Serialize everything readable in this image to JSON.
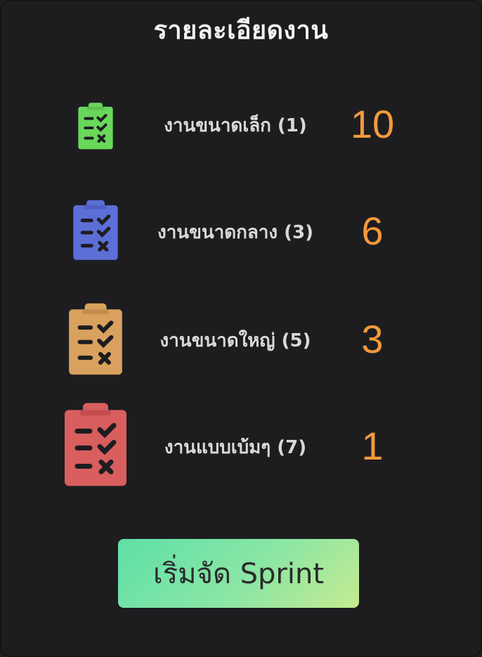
{
  "title": "รายละเอียดงาน",
  "tasks": [
    {
      "label": "งานขนาดเล็ก (1)",
      "count": "10",
      "icon": "clipboard-checklist-icon",
      "color": "#69d75a"
    },
    {
      "label": "งานขนาดกลาง (3)",
      "count": "6",
      "icon": "clipboard-checklist-icon",
      "color": "#5b6fd6"
    },
    {
      "label": "งานขนาดใหญ่ (5)",
      "count": "3",
      "icon": "clipboard-checklist-icon",
      "color": "#d9a15e"
    },
    {
      "label": "งานแบบเบ้มๆ (7)",
      "count": "1",
      "icon": "clipboard-checklist-icon",
      "color": "#d95e5e"
    }
  ],
  "start_button": {
    "label": "เริ่มจัด Sprint"
  },
  "colors": {
    "background": "#1d1d20",
    "count": "#f39a3a",
    "button_gradient_start": "#5fe0a8",
    "button_gradient_end": "#c5ea90"
  }
}
